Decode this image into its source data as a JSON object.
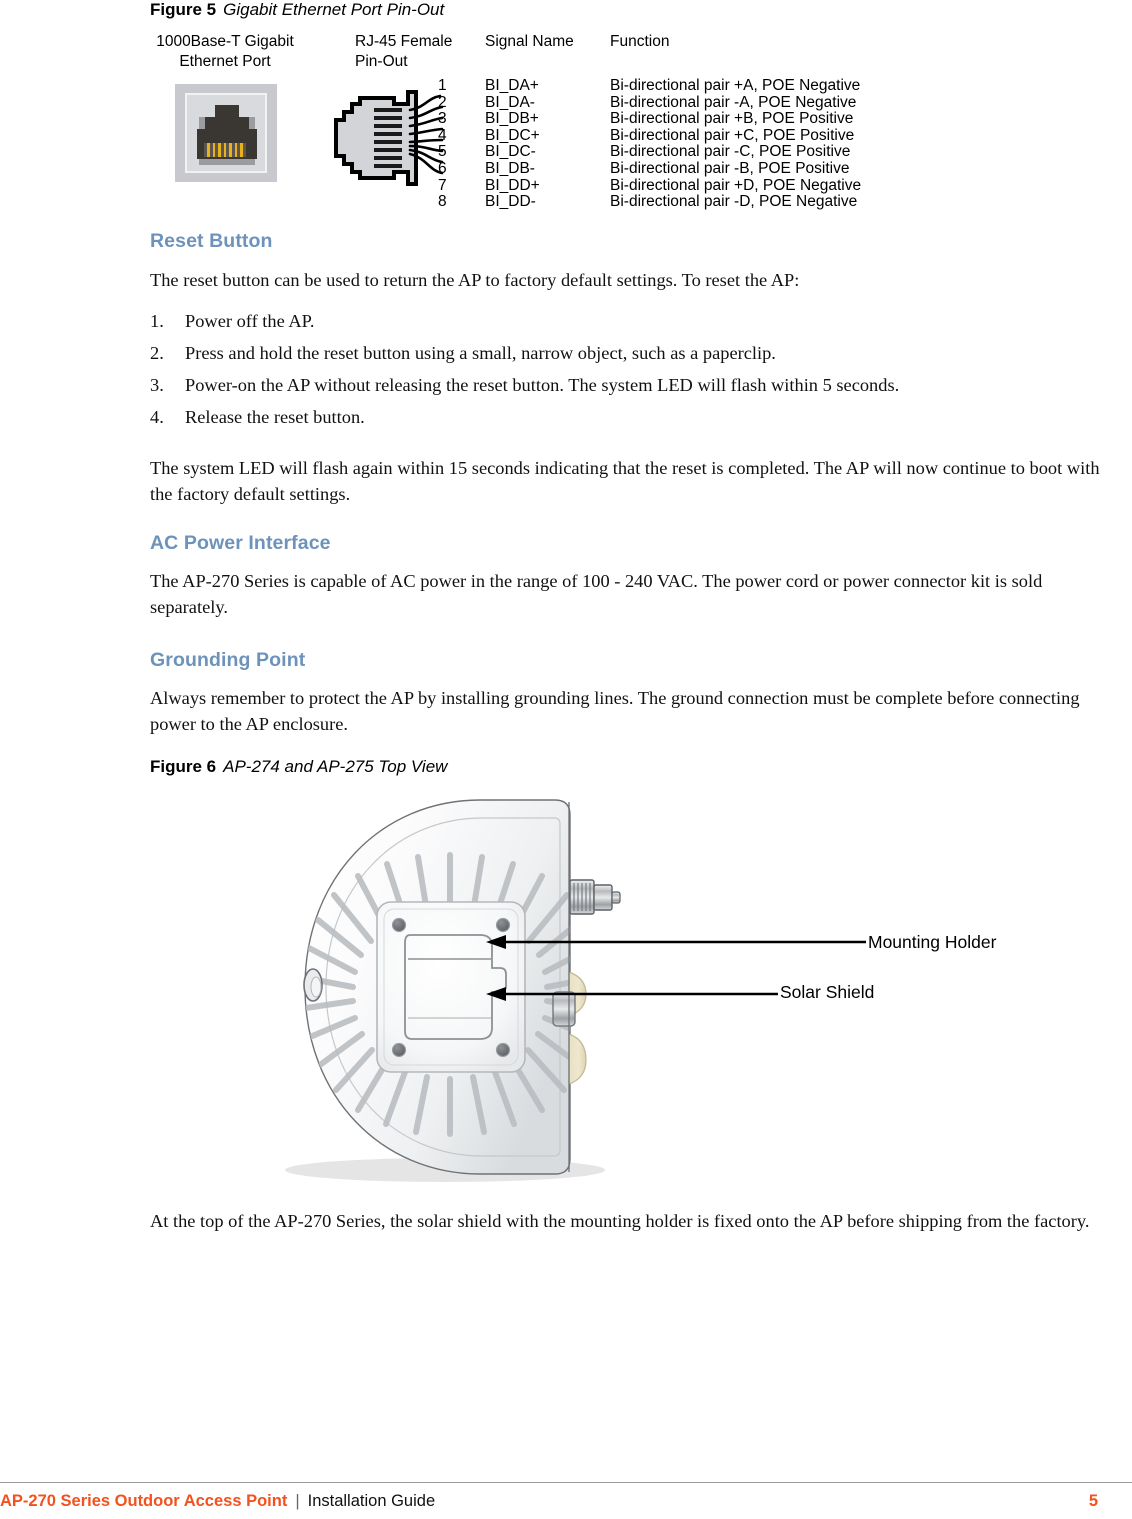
{
  "figure5": {
    "caption_number": "Figure 5",
    "caption_title": "Gigabit Ethernet Port Pin-Out",
    "column_labels": {
      "port": "1000Base-T Gigabit\nEthernet Port",
      "port_line1": "1000Base-T Gigabit",
      "port_line2": "Ethernet Port",
      "pinout_line1": "RJ-45 Female",
      "pinout_line2": "Pin-Out",
      "signal_name": "Signal Name",
      "function": "Function"
    },
    "rows": [
      {
        "pin": "1",
        "signal": "BI_DA+",
        "function": "Bi-directional pair +A, POE Negative"
      },
      {
        "pin": "2",
        "signal": "BI_DA-",
        "function": "Bi-directional pair -A, POE Negative"
      },
      {
        "pin": "3",
        "signal": "BI_DB+",
        "function": "Bi-directional pair +B, POE Positive"
      },
      {
        "pin": "4",
        "signal": "BI_DC+",
        "function": "Bi-directional pair +C, POE Positive"
      },
      {
        "pin": "5",
        "signal": "BI_DC-",
        "function": "Bi-directional pair -C, POE Positive"
      },
      {
        "pin": "6",
        "signal": "BI_DB-",
        "function": "Bi-directional pair -B, POE Positive"
      },
      {
        "pin": "7",
        "signal": "BI_DD+",
        "function": "Bi-directional pair +D, POE Negative"
      },
      {
        "pin": "8",
        "signal": "BI_DD-",
        "function": "Bi-directional pair -D, POE Negative"
      }
    ]
  },
  "sections": {
    "reset_button": {
      "heading": "Reset Button",
      "intro": "The reset button can be used to return the AP to factory default settings. To reset the AP:",
      "steps": [
        {
          "num": "1.",
          "text": "Power off the AP."
        },
        {
          "num": "2.",
          "text": "Press and hold the reset button using a small, narrow object, such as a paperclip."
        },
        {
          "num": "3.",
          "text": "Power-on the AP without releasing the reset button. The system LED will flash within 5 seconds."
        },
        {
          "num": "4.",
          "text": "Release the reset button."
        }
      ],
      "outro": "The system LED will flash again within 15 seconds indicating that the reset is completed. The AP will now continue to boot with the factory default settings."
    },
    "ac_power_interface": {
      "heading": "AC Power Interface",
      "body": "The AP-270 Series is capable of AC power in the range of 100 - 240 VAC. The power cord or power connector kit is sold separately."
    },
    "grounding_point": {
      "heading": "Grounding Point",
      "body": "Always remember to protect the AP by installing grounding lines. The ground connection must be complete before connecting power to the AP enclosure."
    }
  },
  "figure6": {
    "caption_number": "Figure 6",
    "caption_title": "AP-274 and AP-275 Top View",
    "callouts": [
      {
        "label": "Mounting Holder"
      },
      {
        "label": "Solar Shield"
      }
    ],
    "trailing_paragraph": "At the top of the AP-270 Series, the solar shield with the mounting holder is fixed onto the AP before shipping from the factory."
  },
  "footer": {
    "product": "AP-270 Series Outdoor Access Point",
    "separator": "|",
    "guide": "Installation Guide",
    "page_number": "5"
  },
  "colors": {
    "heading_blue": "#6E93BB",
    "footer_orange": "#F4511E",
    "rule_gray": "#9A9A9A"
  }
}
